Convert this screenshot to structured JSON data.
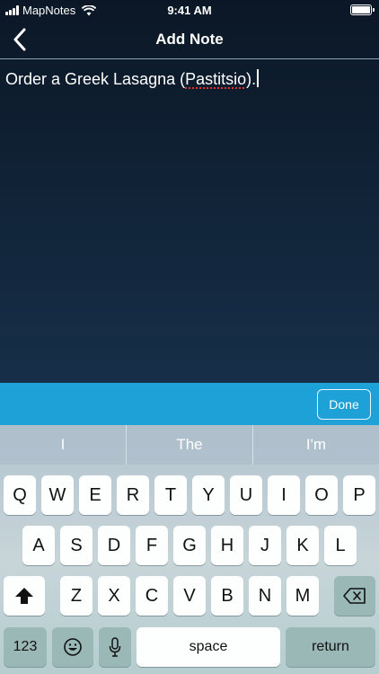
{
  "status_bar": {
    "carrier": "MapNotes",
    "time": "9:41 AM"
  },
  "nav": {
    "title": "Add Note",
    "back_icon": "chevron-left-icon"
  },
  "note": {
    "text_before": "Order a Greek Lasagna (",
    "misspelled_word": "Pastitsio",
    "text_after": ")."
  },
  "accessory": {
    "done_label": "Done"
  },
  "keyboard": {
    "suggestions": [
      "I",
      "The",
      "I'm"
    ],
    "row1": [
      "Q",
      "W",
      "E",
      "R",
      "T",
      "Y",
      "U",
      "I",
      "O",
      "P"
    ],
    "row2": [
      "A",
      "S",
      "D",
      "F",
      "G",
      "H",
      "J",
      "K",
      "L"
    ],
    "row3": [
      "Z",
      "X",
      "C",
      "V",
      "B",
      "N",
      "M"
    ],
    "numbers_label": "123",
    "space_label": "space",
    "return_label": "return",
    "icons": {
      "shift": "shift-icon",
      "delete": "backspace-icon",
      "emoji": "emoji-icon",
      "mic": "microphone-icon"
    }
  }
}
